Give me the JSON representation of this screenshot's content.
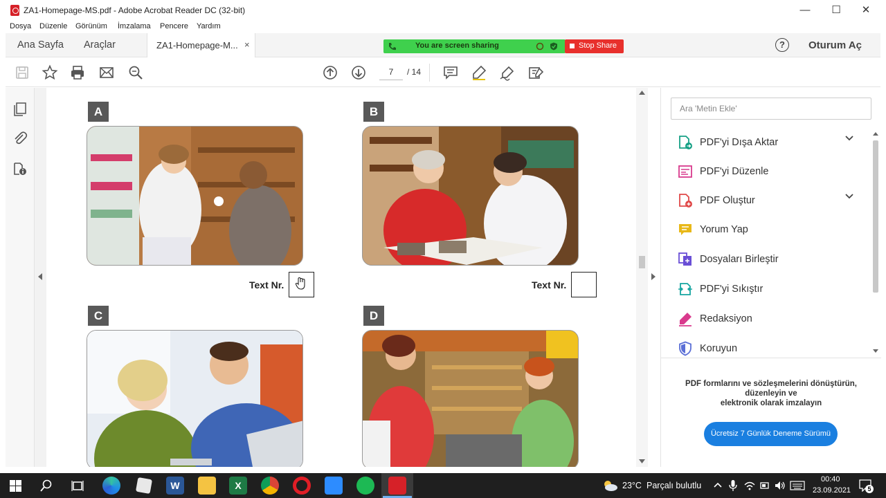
{
  "window": {
    "title": "ZA1-Homepage-MS.pdf - Adobe Acrobat Reader DC (32-bit)",
    "minimize": "—",
    "maximize": "☐",
    "close": "✕"
  },
  "menu": [
    "Dosya",
    "Düzenle",
    "Görünüm",
    "İmzalama",
    "Pencere",
    "Yardım"
  ],
  "tabs": {
    "home": "Ana Sayfa",
    "tools": "Araçlar",
    "document": "ZA1-Homepage-M...",
    "document_close": "×"
  },
  "screen_share": {
    "status": "You are screen sharing",
    "stop_label": "Stop Share"
  },
  "header": {
    "help": "?",
    "signin": "Oturum Aç"
  },
  "toolbar": {
    "page_current": "7",
    "page_total": "/ 14"
  },
  "document": {
    "sections": [
      "A",
      "B",
      "C",
      "D"
    ],
    "text_nr_label": "Text Nr."
  },
  "panel": {
    "search_placeholder": "Ara 'Metin Ekle'",
    "tools": [
      {
        "label": "PDF'yi Dışa Aktar",
        "icon": "export-pdf-icon",
        "color": "#16a085",
        "expandable": true
      },
      {
        "label": "PDF'yi Düzenle",
        "icon": "edit-pdf-icon",
        "color": "#d93a8d",
        "expandable": false
      },
      {
        "label": "PDF Oluştur",
        "icon": "create-pdf-icon",
        "color": "#e04848",
        "expandable": true
      },
      {
        "label": "Yorum Yap",
        "icon": "comment-icon",
        "color": "#e8b818",
        "expandable": false
      },
      {
        "label": "Dosyaları Birleştir",
        "icon": "combine-files-icon",
        "color": "#6a4fd6",
        "expandable": false
      },
      {
        "label": "PDF'yi Sıkıştır",
        "icon": "compress-pdf-icon",
        "color": "#16a5a0",
        "expandable": false
      },
      {
        "label": "Redaksiyon",
        "icon": "redact-icon",
        "color": "#d93a8d",
        "expandable": false
      },
      {
        "label": "Koruyun",
        "icon": "protect-icon",
        "color": "#5b6fd6",
        "expandable": false
      }
    ],
    "promo_lines": [
      "PDF formlarını ve sözleşmelerini dönüştürün,",
      "düzenleyin ve",
      "elektronik olarak imzalayın"
    ],
    "promo_button": "Ücretsiz 7 Günlük Deneme Sürümü"
  },
  "taskbar": {
    "weather_temp": "23°C",
    "weather_desc": "Parçalı bulutlu",
    "time": "00:40",
    "date": "23.09.2021",
    "notification_count": "5"
  },
  "colors": {
    "share_green": "#3fd04d",
    "stop_red": "#e8302c",
    "promo_blue": "#1a7fe0",
    "acrobat_red": "#d62128"
  }
}
